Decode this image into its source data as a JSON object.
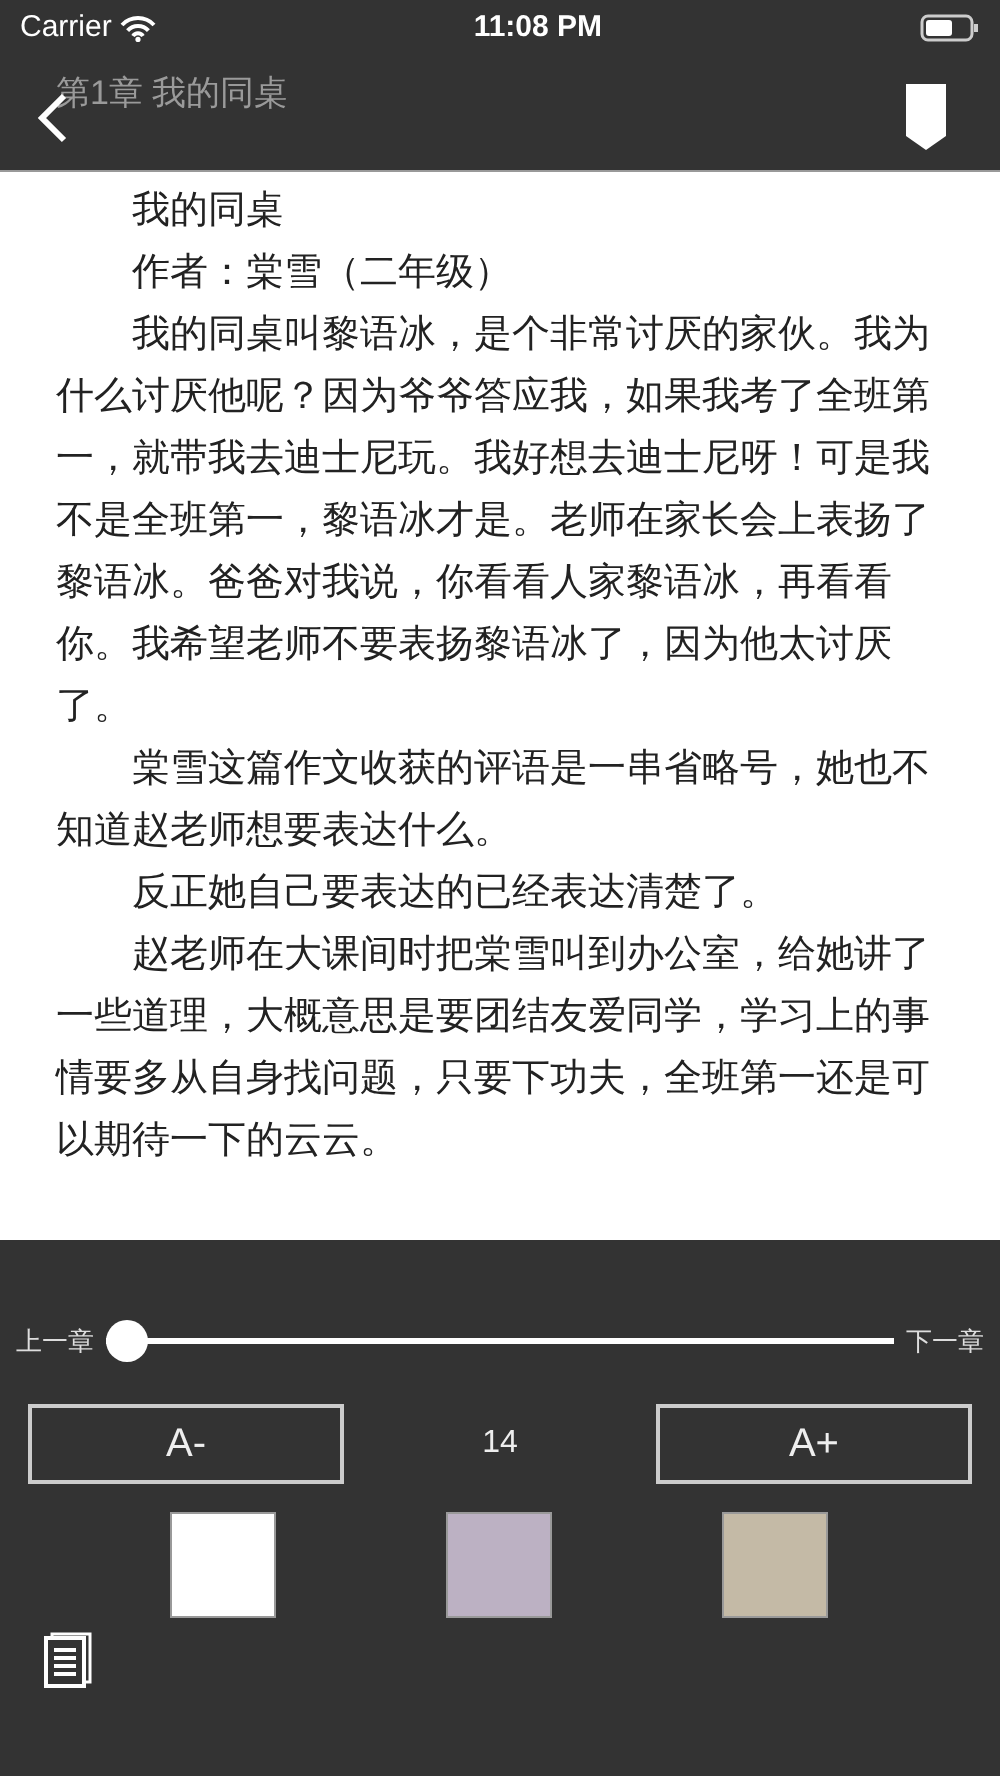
{
  "status_bar": {
    "carrier": "Carrier",
    "time": "11:08 PM"
  },
  "nav_bar": {
    "chapter_title": "第1章 我的同桌"
  },
  "article": {
    "paragraphs": [
      "我的同桌",
      "作者：棠雪（二年级）",
      "我的同桌叫黎语冰，是个非常讨厌的家伙。我为什么讨厌他呢？因为爷爷答应我，如果我考了全班第一，就带我去迪士尼玩。我好想去迪士尼呀！可是我不是全班第一，黎语冰才是。老师在家长会上表扬了黎语冰。爸爸对我说，你看看人家黎语冰，再看看你。我希望老师不要表扬黎语冰了，因为他太讨厌了。",
      "棠雪这篇作文收获的评语是一串省略号，她也不知道赵老师想要表达什么。",
      "反正她自己要表达的已经表达清楚了。",
      "赵老师在大课间时把棠雪叫到办公室，给她讲了一些道理，大概意思是要团结友爱同学，学习上的事情要多从自身找问题，只要下功夫，全班第一还是可以期待一下的云云。"
    ]
  },
  "settings_panel": {
    "prev_label": "上一章",
    "next_label": "下一章",
    "chapter_slider": {
      "level": 0
    },
    "decrease_button": "A-",
    "font_size": "14",
    "increase_button": "A+",
    "background_swatches": [
      {
        "color": "#ffffff"
      },
      {
        "color": "#bcb1c3"
      },
      {
        "color": "#c4baa6"
      }
    ]
  }
}
